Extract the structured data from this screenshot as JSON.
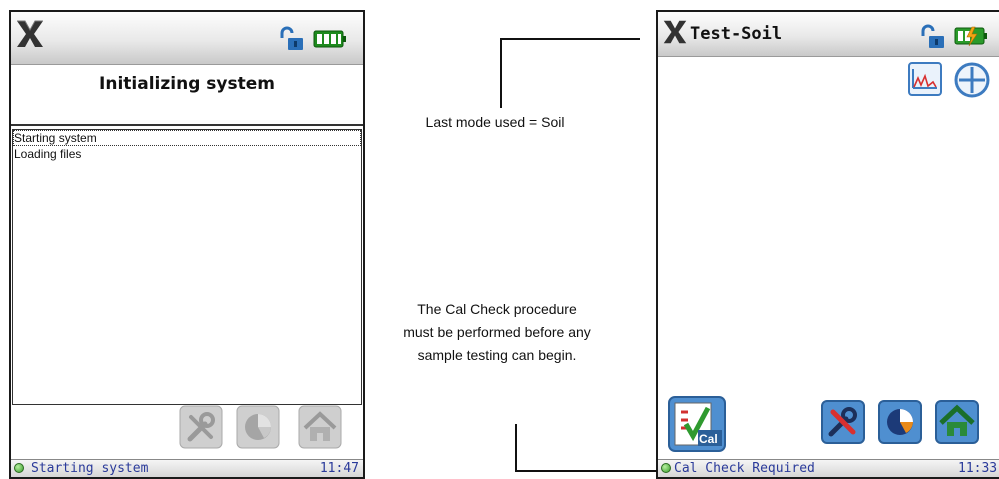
{
  "left_device": {
    "init_title": "Initializing system",
    "log_items": [
      "Starting system",
      "Loading files"
    ],
    "status_text": "Starting system",
    "status_time": "11:47",
    "buttons": [
      {
        "name": "settings-button",
        "icon": "wrench-screwdriver-icon",
        "state": "disabled"
      },
      {
        "name": "results-button",
        "icon": "pie-chart-icon",
        "state": "disabled"
      },
      {
        "name": "home-button",
        "icon": "home-icon",
        "state": "disabled"
      }
    ]
  },
  "right_device": {
    "app_title": "Test-Soil",
    "status_text": "Cal Check Required",
    "status_time": "11:33",
    "top_buttons": [
      {
        "name": "spectrum-button",
        "icon": "spectrum-chart-icon"
      },
      {
        "name": "add-button",
        "icon": "plus-circle-icon"
      }
    ],
    "cal_button_label": "Cal",
    "buttons": [
      {
        "name": "settings-button",
        "icon": "wrench-screwdriver-icon",
        "state": "enabled"
      },
      {
        "name": "results-button",
        "icon": "pie-chart-icon",
        "state": "enabled"
      },
      {
        "name": "home-button",
        "icon": "home-icon",
        "state": "enabled"
      }
    ]
  },
  "annotations": {
    "mode_note": "Last mode used = Soil",
    "cal_note_line1": "The Cal Check procedure",
    "cal_note_line2": "must be performed before any",
    "cal_note_line3": "sample testing can begin."
  },
  "colors": {
    "status_text": "#2a3a9a",
    "status_ok": "#3a9d2a",
    "button_blue": "#3d7bc0",
    "disabled_grey": "#b5b5b5"
  }
}
